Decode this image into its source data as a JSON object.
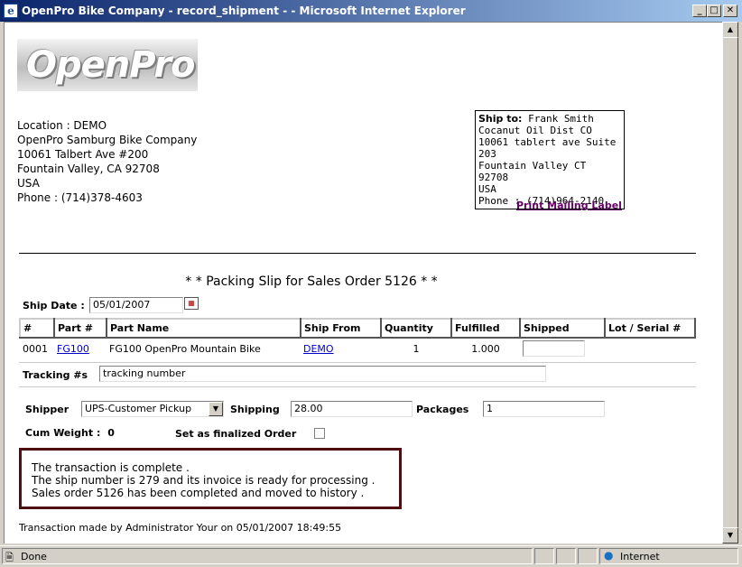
{
  "window": {
    "title": "OpenPro Bike Company - record_shipment - - Microsoft Internet Explorer",
    "minimize": "_",
    "maximize": "□",
    "close": "✕"
  },
  "logo": {
    "text": "OpenPro"
  },
  "company": {
    "location": "Location : DEMO",
    "name": "OpenPro Samburg Bike Company",
    "address1": "10061 Talbert Ave #200",
    "city": "Fountain Valley, CA 92708",
    "country": "USA",
    "phone": "Phone : (714)378-4603"
  },
  "ship_to": {
    "label": "Ship to:",
    "name": "Frank Smith",
    "company": "Cocanut Oil Dist CO",
    "address": "10061 tablert ave Suite 203",
    "city": "Fountain Valley CT 92708",
    "country": "USA",
    "phone": "Phone : (714)964-2140"
  },
  "print_label_link": "Print Mailing Label",
  "heading": "* * Packing Slip for Sales Order 5126 * *",
  "ship_date": {
    "label": "Ship Date :",
    "value": "05/01/2007"
  },
  "table": {
    "headers": [
      "#",
      "Part #",
      "Part Name",
      "Ship From",
      "Quantity",
      "Fulfilled",
      "Shipped",
      "Lot / Serial #"
    ],
    "rows": [
      {
        "num": "0001",
        "part": "FG100",
        "name": "FG100 OpenPro Mountain Bike",
        "ship_from": "DEMO",
        "quantity": "1",
        "fulfilled": "1.000",
        "shipped": ""
      }
    ]
  },
  "tracking": {
    "label": "Tracking #s",
    "value": "tracking number"
  },
  "shipper": {
    "label": "Shipper",
    "value": "UPS-Customer Pickup"
  },
  "shipping": {
    "label": "Shipping",
    "value": "28.00"
  },
  "packages": {
    "label": "Packages",
    "value": "1"
  },
  "cum_weight": {
    "label": "Cum Weight :",
    "value": "0"
  },
  "finalized": {
    "label": "Set as finalized Order",
    "checked": false
  },
  "messages": [
    "The transaction is complete .",
    "The ship number is 279 and its invoice is ready for processing .",
    "Sales order 5126 has been completed and moved to history ."
  ],
  "footer": "Transaction made by Administrator Your on 05/01/2007 18:49:55",
  "status": {
    "text": "Done",
    "zone": "Internet"
  },
  "colors": {
    "titlebar": "#0a246a",
    "visited_link": "#660066",
    "link": "#0000cc",
    "message_border": "#4d0f0f"
  }
}
